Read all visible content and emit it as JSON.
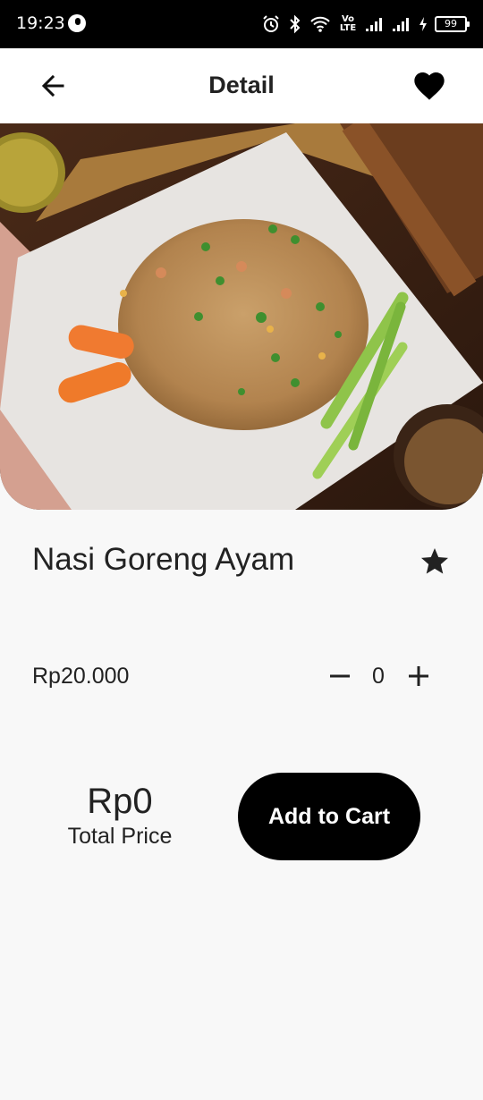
{
  "status_bar": {
    "time": "19:23",
    "volte": "Vo LTE",
    "battery": "99"
  },
  "header": {
    "title": "Detail",
    "back_icon": "arrow-back-icon",
    "favorite_icon": "heart-icon"
  },
  "product": {
    "image_alt": "Nasi Goreng Ayam",
    "name": "Nasi Goreng Ayam",
    "rating_icon": "star-icon",
    "price": "Rp20.000",
    "quantity": "0"
  },
  "footer": {
    "total_value": "Rp0",
    "total_label": "Total Price",
    "add_to_cart_label": "Add to Cart"
  },
  "colors": {
    "background": "#f8f8f8",
    "primary": "#000000",
    "text": "#222222"
  }
}
